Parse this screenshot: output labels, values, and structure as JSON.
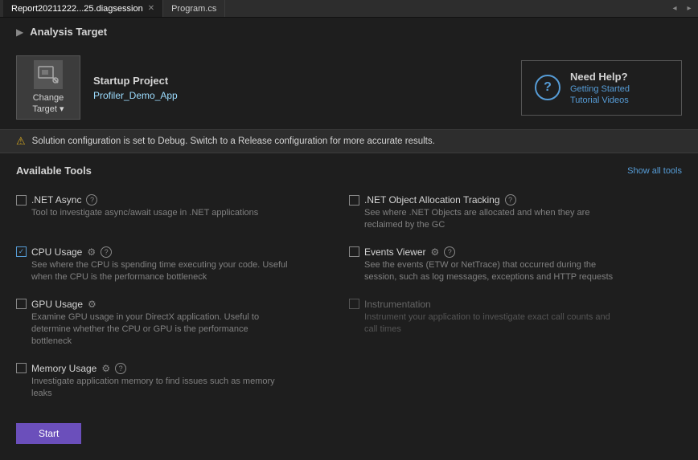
{
  "titleBar": {
    "tabs": [
      {
        "label": "Report20211222...25.diagsession",
        "active": true,
        "closable": true
      },
      {
        "label": "Program.cs",
        "active": false,
        "closable": false
      }
    ],
    "controls": [
      "chevron-down"
    ]
  },
  "sectionHeader": {
    "title": "Analysis Target"
  },
  "analysisTarget": {
    "changeTarget": {
      "label": "Change\nTarget",
      "dropdownArrow": "▾"
    },
    "startupProject": {
      "label": "Startup Project",
      "projectName": "Profiler_Demo_App"
    },
    "needHelp": {
      "title": "Need Help?",
      "links": [
        "Getting Started",
        "Tutorial Videos"
      ]
    }
  },
  "warning": {
    "text": "Solution configuration is set to Debug. Switch to a Release configuration for more accurate results."
  },
  "availableTools": {
    "title": "Available Tools",
    "showAllTools": "Show all tools",
    "tools": [
      {
        "id": "net-async",
        "name": ".NET Async",
        "checked": false,
        "disabled": false,
        "hasInfo": true,
        "hasGear": false,
        "description": "Tool to investigate async/await usage in .NET applications",
        "column": 0
      },
      {
        "id": "net-object-allocation",
        "name": ".NET Object Allocation Tracking",
        "checked": false,
        "disabled": false,
        "hasInfo": true,
        "hasGear": false,
        "description": "See where .NET Objects are allocated and when they are reclaimed by the GC",
        "column": 1
      },
      {
        "id": "cpu-usage",
        "name": "CPU Usage",
        "checked": true,
        "disabled": false,
        "hasInfo": true,
        "hasGear": true,
        "description": "See where the CPU is spending time executing your code. Useful when the CPU is the performance bottleneck",
        "column": 0
      },
      {
        "id": "events-viewer",
        "name": "Events Viewer",
        "checked": false,
        "disabled": false,
        "hasInfo": true,
        "hasGear": true,
        "description": "See the events (ETW or NetTrace) that occurred during the session, such as log messages, exceptions and HTTP requests",
        "column": 1
      },
      {
        "id": "gpu-usage",
        "name": "GPU Usage",
        "checked": false,
        "disabled": false,
        "hasInfo": false,
        "hasGear": true,
        "description": "Examine GPU usage in your DirectX application. Useful to determine whether the CPU or GPU is the performance bottleneck",
        "column": 0
      },
      {
        "id": "instrumentation",
        "name": "Instrumentation",
        "checked": false,
        "disabled": true,
        "hasInfo": false,
        "hasGear": false,
        "description": "Instrument your application to investigate exact call counts and call times",
        "column": 1
      },
      {
        "id": "memory-usage",
        "name": "Memory Usage",
        "checked": false,
        "disabled": false,
        "hasInfo": true,
        "hasGear": true,
        "description": "Investigate application memory to find issues such as memory leaks",
        "column": 0
      }
    ]
  },
  "startButton": {
    "label": "Start"
  }
}
